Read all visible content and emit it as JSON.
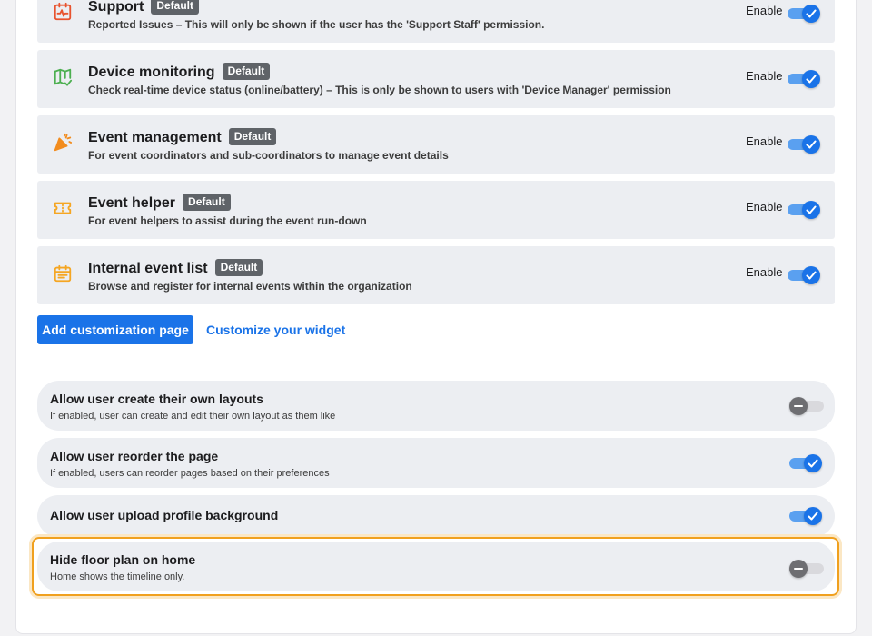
{
  "pages": [
    {
      "title": "Support",
      "badge": "Default",
      "description": "Reported Issues – This will only be shown if the user has the 'Support Staff' permission.",
      "enable_label": "Enable",
      "enabled": true,
      "icon": "support-icon",
      "icon_color": "#e8532e"
    },
    {
      "title": "Device monitoring",
      "badge": "Default",
      "description": "Check real-time device status (online/battery) – This is only be shown to users with 'Device Manager' permission",
      "enable_label": "Enable",
      "enabled": true,
      "icon": "map-check-icon",
      "icon_color": "#4caf50"
    },
    {
      "title": "Event management",
      "badge": "Default",
      "description": "For event coordinators and sub-coordinators to manage event details",
      "enable_label": "Enable",
      "enabled": true,
      "icon": "party-popper-icon",
      "icon_color": "#f28c1e"
    },
    {
      "title": "Event helper",
      "badge": "Default",
      "description": "For event helpers to assist during the event run-down",
      "enable_label": "Enable",
      "enabled": true,
      "icon": "ticket-icon",
      "icon_color": "#f5a623"
    },
    {
      "title": "Internal event list",
      "badge": "Default",
      "description": "Browse and register for internal events within the organization",
      "enable_label": "Enable",
      "enabled": true,
      "icon": "calendar-icon",
      "icon_color": "#f5a623"
    }
  ],
  "actions": {
    "add_page_label": "Add customization page",
    "customize_widget_label": "Customize your widget"
  },
  "settings": [
    {
      "title": "Allow user create their own layouts",
      "description": "If enabled, user can create and edit their own layout as them like",
      "enabled": false
    },
    {
      "title": "Allow user reorder the page",
      "description": "If enabled, users can reorder pages based on their preferences",
      "enabled": true
    },
    {
      "title": "Allow user upload profile background",
      "description": "",
      "enabled": true
    },
    {
      "title": "Hide floor plan on home",
      "description": "Home shows the timeline only.",
      "enabled": false,
      "highlighted": true
    }
  ],
  "colors": {
    "accent": "#1a73e8",
    "badge": "#5f6368",
    "highlight": "#f0a01e"
  }
}
